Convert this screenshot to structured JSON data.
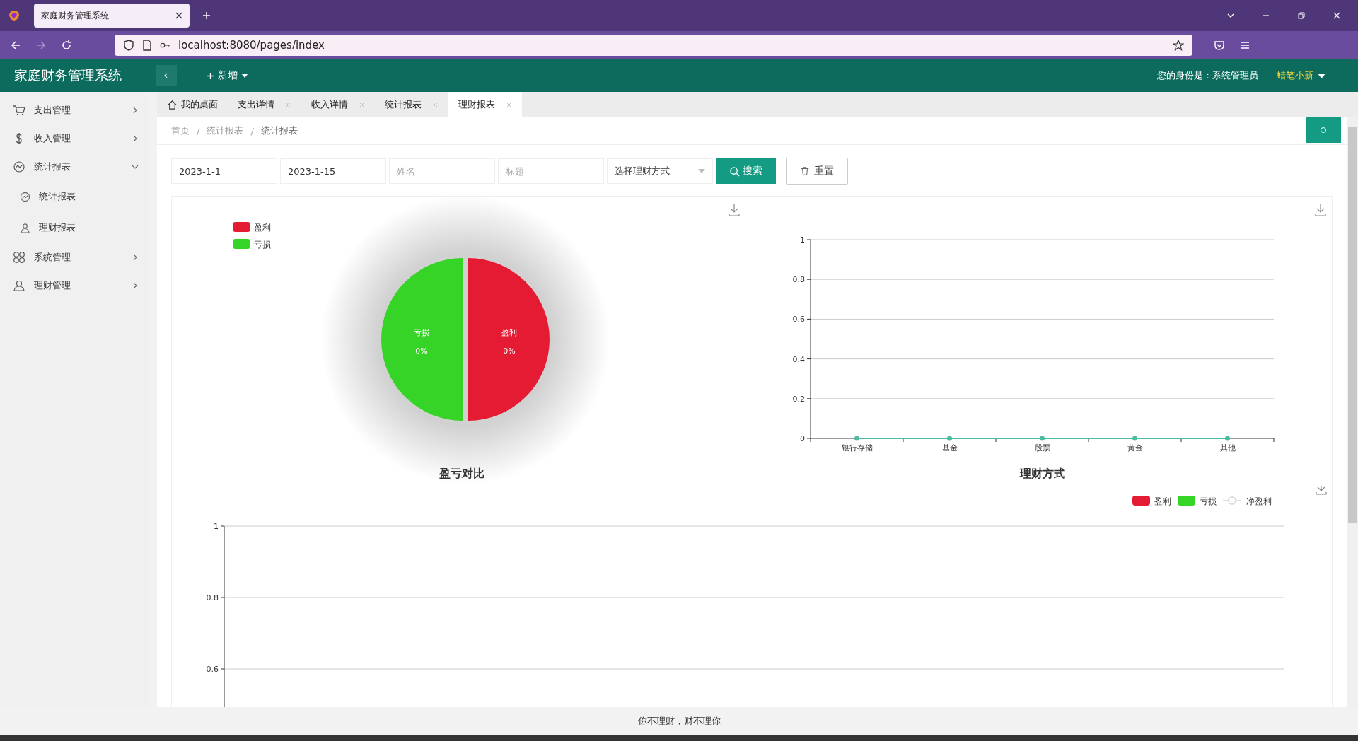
{
  "browser": {
    "tab_title": "家庭财务管理系统",
    "url": "localhost:8080/pages/index"
  },
  "header": {
    "title": "家庭财务管理系统",
    "add_label": "新增",
    "identity_label": "您的身份是：系统管理员",
    "user_name": "蜡笔小新"
  },
  "sidebar": {
    "items": [
      {
        "label": "支出管理",
        "expanded": false
      },
      {
        "label": "收入管理",
        "expanded": false
      },
      {
        "label": "统计报表",
        "expanded": true,
        "children": [
          {
            "label": "统计报表"
          },
          {
            "label": "理财报表"
          }
        ]
      },
      {
        "label": "系统管理",
        "expanded": false
      },
      {
        "label": "理财管理",
        "expanded": false
      }
    ]
  },
  "tabs": [
    {
      "label": "我的桌面",
      "closable": false,
      "selected": false
    },
    {
      "label": "支出详情",
      "closable": true,
      "selected": false
    },
    {
      "label": "收入详情",
      "closable": true,
      "selected": false
    },
    {
      "label": "统计报表",
      "closable": true,
      "selected": false
    },
    {
      "label": "理财报表",
      "closable": true,
      "selected": true
    }
  ],
  "breadcrumb": [
    {
      "kind": "link",
      "text": "首页"
    },
    {
      "kind": "separator",
      "text": "/"
    },
    {
      "kind": "link",
      "text": "统计报表"
    },
    {
      "kind": "separator",
      "text": "/"
    },
    {
      "kind": "current",
      "text": "统计报表"
    }
  ],
  "filters": {
    "start_date": "2023-1-1",
    "end_date": "2023-1-15",
    "name_placeholder": "姓名",
    "title_placeholder": "标题",
    "method_placeholder": "选择理财方式",
    "search_button": "搜索",
    "reset_button": "重置"
  },
  "charts": [
    {
      "kind": "pie",
      "title": "盈亏对比",
      "legend": [
        {
          "label": "盈利",
          "color": "#e41b33"
        },
        {
          "label": "亏损",
          "color": "#36d426"
        }
      ],
      "slices": [
        {
          "name": "亏损",
          "percent": "0%",
          "color": "#36d426"
        },
        {
          "name": "盈利",
          "percent": "0%",
          "color": "#e41b33"
        }
      ]
    },
    {
      "kind": "line",
      "title": "理财方式",
      "chart_data": {
        "type": "line",
        "categories": [
          "银行存储",
          "基金",
          "股票",
          "黄金",
          "其他"
        ],
        "series": [
          {
            "color": "#4dbaa2",
            "values": [
              0,
              0,
              0,
              0,
              0
            ],
            "marker": true
          }
        ],
        "ylim": [
          0,
          1
        ],
        "yticks": [
          0,
          0.2,
          0.4,
          0.6,
          0.8,
          1
        ],
        "grid": true
      }
    },
    {
      "kind": "axis",
      "axis_ticks": [
        "1",
        "0.8",
        "0.6"
      ],
      "legend": [
        {
          "label": "盈利",
          "color": "#e41b33",
          "kind": "bar"
        },
        {
          "label": "亏损",
          "color": "#36d426",
          "kind": "bar"
        },
        {
          "label": "净盈利",
          "color": "#dddddd",
          "kind": "line"
        }
      ]
    }
  ],
  "footer": "你不理财，财不理你"
}
